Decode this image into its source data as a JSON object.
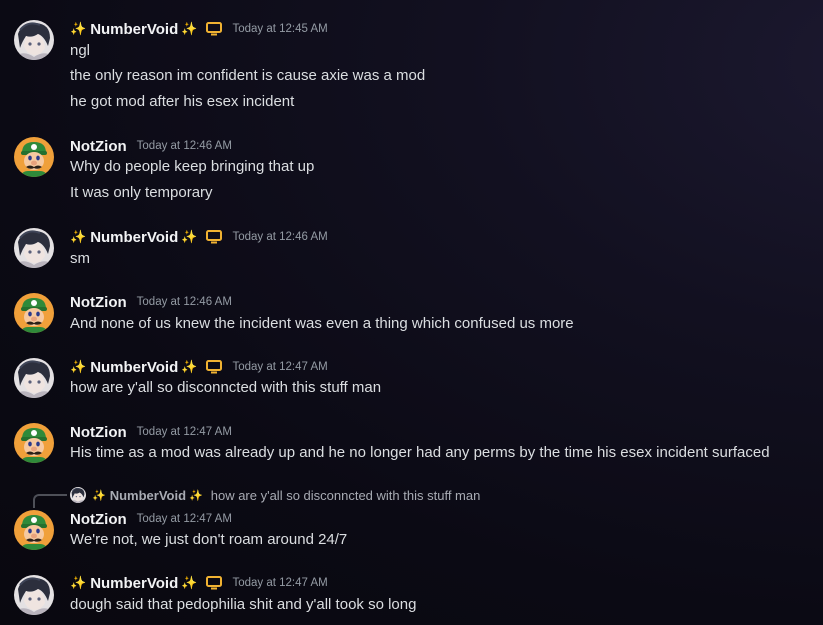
{
  "colors": {
    "background": "#0b0a14",
    "username": "#f2f3f5",
    "timestamp": "#949ba4",
    "message_text": "#dbdee1",
    "sparkle": "#f4c542",
    "monitor_icon": "#f0b232"
  },
  "users": {
    "numbervoid": {
      "name": "NumberVoid",
      "sparkle_icon": "sparkles-icon",
      "badge_icon": "monitor-icon",
      "avatar": "anime-character-avatar"
    },
    "notzion": {
      "name": "NotZion",
      "avatar": "luigi-avatar"
    }
  },
  "messages": [
    {
      "author": "NumberVoid",
      "timestamp": "Today at 12:45 AM",
      "lines": [
        "ngl",
        "the only reason im confident is cause axie was a mod",
        "he got mod after his esex incident"
      ]
    },
    {
      "author": "NotZion",
      "timestamp": "Today at 12:46 AM",
      "lines": [
        "Why do people keep bringing that up",
        "It was only temporary"
      ]
    },
    {
      "author": "NumberVoid",
      "timestamp": "Today at 12:46 AM",
      "lines": [
        "sm"
      ]
    },
    {
      "author": "NotZion",
      "timestamp": "Today at 12:46 AM",
      "lines": [
        "And none of us knew the incident was even a thing which confused us more"
      ]
    },
    {
      "author": "NumberVoid",
      "timestamp": "Today at 12:47 AM",
      "lines": [
        "how are y'all so disconncted with this stuff man"
      ]
    },
    {
      "author": "NotZion",
      "timestamp": "Today at 12:47 AM",
      "lines": [
        "His time as a mod was already up and he no longer had any perms by the time his esex incident surfaced"
      ]
    },
    {
      "author": "NotZion",
      "timestamp": "Today at 12:47 AM",
      "reply": {
        "author": "NumberVoid",
        "text": "how are y'all so disconncted with this stuff man"
      },
      "lines": [
        "We're not, we just don't roam around 24/7"
      ]
    },
    {
      "author": "NumberVoid",
      "timestamp": "Today at 12:47 AM",
      "lines": [
        "dough said that pedophilia shit and y'all took so long"
      ]
    }
  ]
}
